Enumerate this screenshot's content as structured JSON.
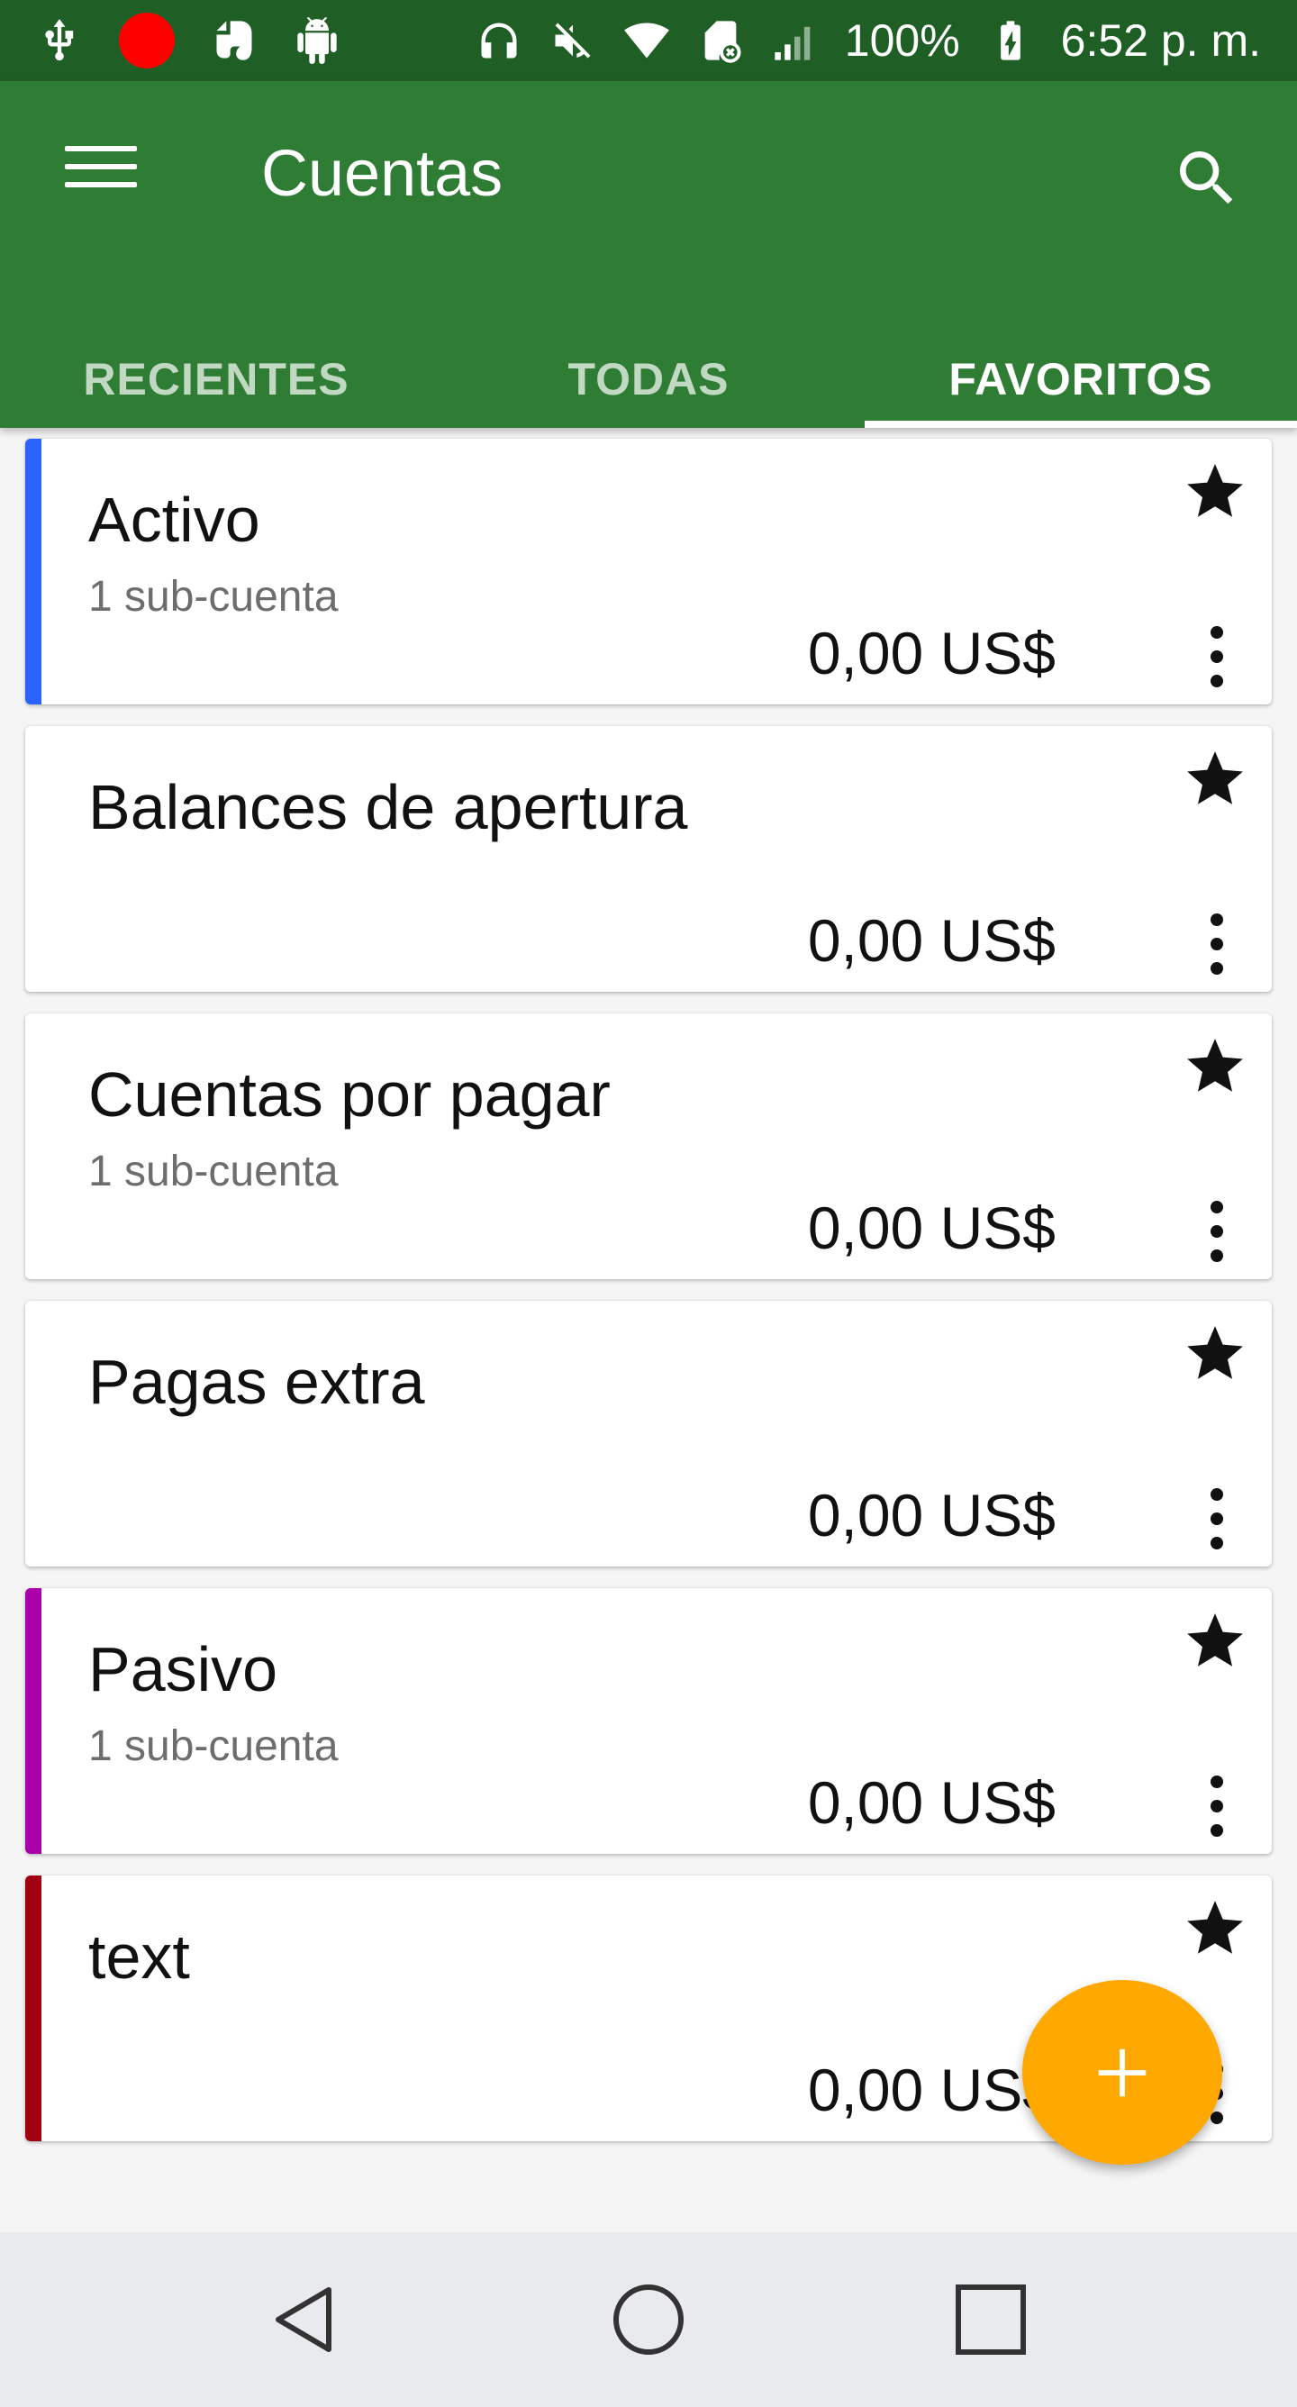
{
  "status_bar": {
    "battery": "100%",
    "time": "6:52 p. m.",
    "icons_left": [
      "usb-icon",
      "record-icon",
      "evernote-icon",
      "android-debug-icon"
    ],
    "icons_right": [
      "headphones-icon",
      "mute-icon",
      "wifi-icon",
      "no-sim-icon",
      "signal-icon",
      "battery-charging-icon"
    ]
  },
  "app_bar": {
    "title": "Cuentas",
    "background": "#2f7d34",
    "menu_icon": "menu-icon",
    "search_icon": "search-icon"
  },
  "tabs": [
    {
      "label": "RECIENTES",
      "active": false
    },
    {
      "label": "TODAS",
      "active": false
    },
    {
      "label": "FAVORITOS",
      "active": true
    }
  ],
  "accounts": [
    {
      "name": "Activo",
      "sub": "1 sub-cuenta",
      "balance": "0,00 US$",
      "color": "#2962ff",
      "favorite": true
    },
    {
      "name": "Balances de apertura",
      "sub": "",
      "balance": "0,00 US$",
      "color": "",
      "favorite": true
    },
    {
      "name": "Cuentas por pagar",
      "sub": "1 sub-cuenta",
      "balance": "0,00 US$",
      "color": "",
      "favorite": true
    },
    {
      "name": "Pagas extra",
      "sub": "",
      "balance": "0,00 US$",
      "color": "",
      "favorite": true
    },
    {
      "name": "Pasivo",
      "sub": "1 sub-cuenta",
      "balance": "0,00 US$",
      "color": "#aa00aa",
      "favorite": true
    },
    {
      "name": "text",
      "sub": "",
      "balance": "0,00 US$",
      "color": "#a00010",
      "favorite": true
    }
  ],
  "fab": {
    "icon": "add-icon",
    "color": "#ffa800"
  },
  "nav_bar": {
    "icons": [
      "back-icon",
      "home-icon",
      "recents-icon"
    ]
  }
}
